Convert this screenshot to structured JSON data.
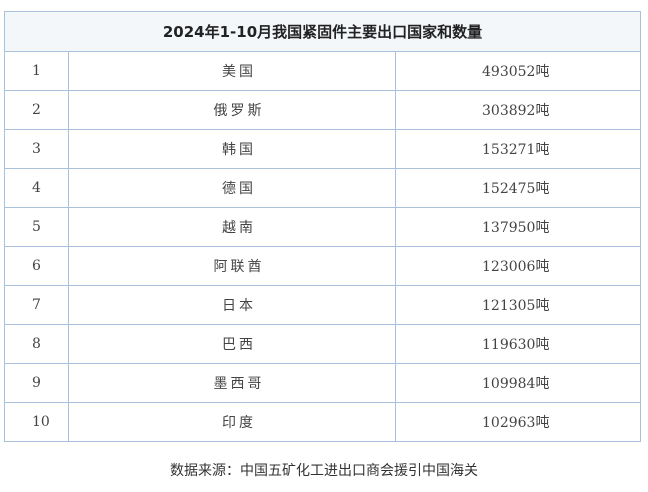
{
  "table": {
    "title": "2024年1-10月我国紧固件主要出口国家和数量",
    "rows": [
      {
        "rank": "1",
        "country": "美国",
        "amount": "493052吨"
      },
      {
        "rank": "2",
        "country": "俄罗斯",
        "amount": "303892吨"
      },
      {
        "rank": "3",
        "country": "韩国",
        "amount": "153271吨"
      },
      {
        "rank": "4",
        "country": "德国",
        "amount": "152475吨"
      },
      {
        "rank": "5",
        "country": "越南",
        "amount": "137950吨"
      },
      {
        "rank": "6",
        "country": "阿联酋",
        "amount": "123006吨"
      },
      {
        "rank": "7",
        "country": "日本",
        "amount": "121305吨"
      },
      {
        "rank": "8",
        "country": "巴西",
        "amount": "119630吨"
      },
      {
        "rank": "9",
        "country": "墨西哥",
        "amount": "109984吨"
      },
      {
        "rank": "10",
        "country": "印度",
        "amount": "102963吨"
      }
    ]
  },
  "source": "数据来源：中国五矿化工进出口商会援引中国海关",
  "colors": {
    "border": "#a9c1db",
    "header_background": "#f3f7fa"
  }
}
